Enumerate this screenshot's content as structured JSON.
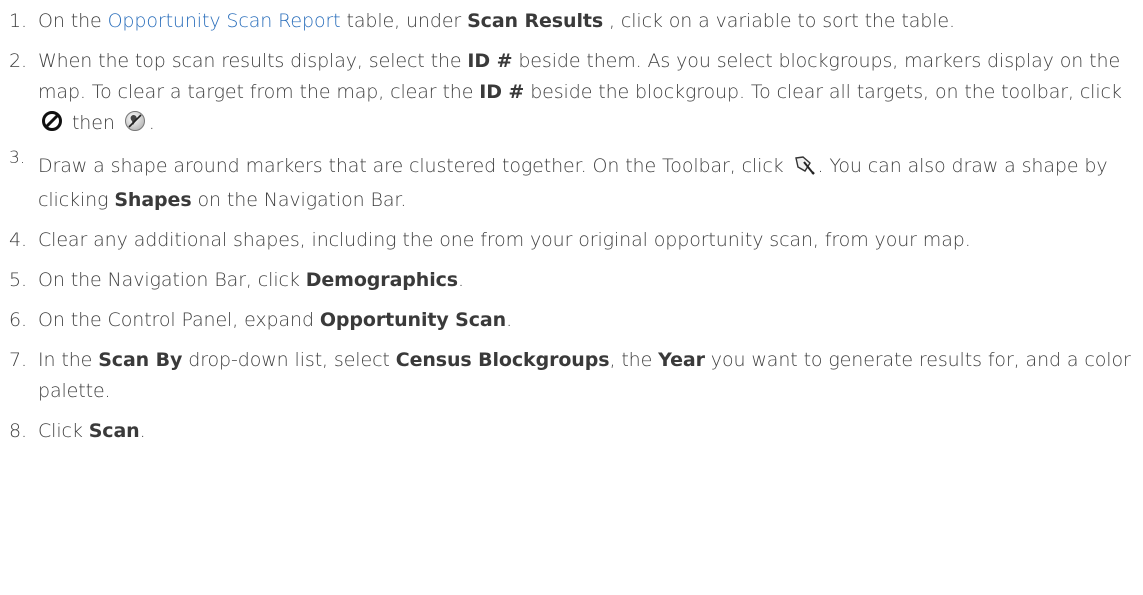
{
  "steps": [
    {
      "num": "1.",
      "pre": "On the ",
      "link": "Opportunity Scan Report",
      "mid": " table, under ",
      "bold": "Scan Results",
      "post": " , click on a variable to sort the table."
    },
    {
      "num": "2.",
      "t1": "When the top scan results display, select the ",
      "b1": "ID #",
      "t2": " beside them. As you select blockgroups, markers display on the map. To clear a target from the map, clear the ",
      "b2": "ID #",
      "t3": " beside the blockgroup. To clear all targets, on the toolbar, click ",
      "t4": " then ",
      "t5": ".",
      "icons": [
        "clear-targets-icon",
        "clear-markers-icon"
      ]
    },
    {
      "num": "3.",
      "t1": "Draw a shape around markers that are clustered together. On the Toolbar, click ",
      "t2": ". You can also draw a shape by clicking ",
      "b1": "Shapes",
      "t3": " on the Navigation Bar.",
      "icon": "draw-shape-icon"
    },
    {
      "num": "4.",
      "t1": "Clear any additional shapes, including the one from your original opportunity scan, from your map."
    },
    {
      "num": "5.",
      "t1": "On the Navigation Bar, click ",
      "b1": "Demographics",
      "t2": "."
    },
    {
      "num": "6.",
      "t1": "On the Control Panel, expand ",
      "b1": "Opportunity Scan",
      "t2": "."
    },
    {
      "num": "7.",
      "t1": "In the ",
      "b1": "Scan By",
      "t2": " drop-down list, select ",
      "b2": "Census Blockgroups",
      "t3": ", the ",
      "b3": "Year",
      "t4": " you want to generate results for, and a color palette."
    },
    {
      "num": "8.",
      "t1": "Click ",
      "b1": "Scan",
      "t2": "."
    }
  ]
}
